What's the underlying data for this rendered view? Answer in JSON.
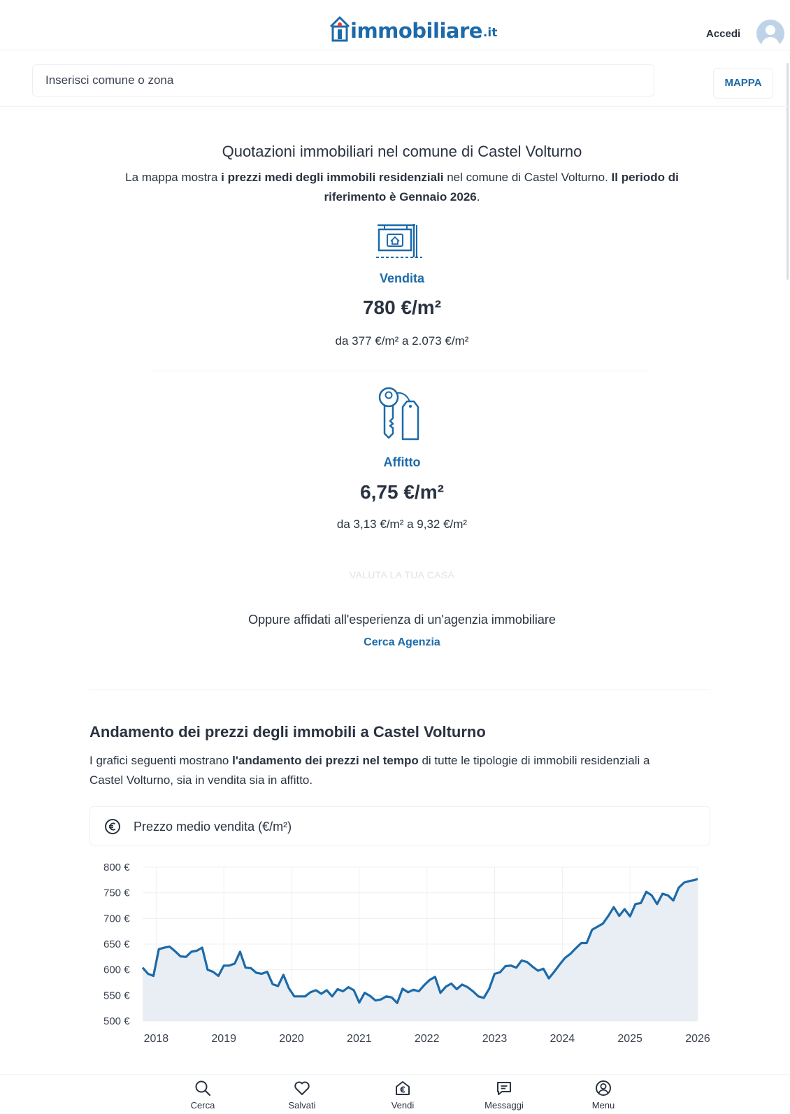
{
  "header": {
    "logo_text": "immobiliare",
    "logo_tld": ".it",
    "login_label": "Accedi"
  },
  "search": {
    "placeholder": "Inserisci comune o zona",
    "map_button_label": "MAPPA"
  },
  "quotes": {
    "title": "Quotazioni immobiliari nel comune di Castel Volturno",
    "desc_part1": "La mappa mostra ",
    "desc_bold1": "i prezzi medi degli immobili residenziali",
    "desc_part2": " nel comune di Castel Volturno. ",
    "desc_bold2": "Il periodo di riferimento è Gennaio 2026",
    "desc_part3": ".",
    "sale": {
      "label": "Vendita",
      "value": "780 €/m²",
      "range": "da 377 €/m² a 2.073 €/m²"
    },
    "rent": {
      "label": "Affitto",
      "value": "6,75 €/m²",
      "range": "da 3,13 €/m² a 9,32 €/m²"
    },
    "valuation_button_label": "VALUTA LA TUA CASA",
    "agency_text": "Oppure affidati all'esperienza di un'agenzia immobiliare",
    "agency_link_label": "Cerca Agenzia"
  },
  "trend": {
    "title": "Andamento dei prezzi degli immobili a Castel Volturno",
    "desc_part1": "I grafici seguenti mostrano ",
    "desc_bold": "l'andamento dei prezzi nel tempo",
    "desc_part2": " di tutte le tipologie di immobili residenziali a Castel Volturno, sia in vendita sia in affitto.",
    "chart_title": "Prezzo medio vendita (€/m²)"
  },
  "chart_data": {
    "type": "area",
    "title": "Prezzo medio vendita (€/m²)",
    "ylim": [
      500,
      800
    ],
    "xlim": [
      2017.8,
      2026
    ],
    "y_ticks": [
      500,
      550,
      600,
      650,
      700,
      750,
      800
    ],
    "y_tick_labels": [
      "500 €",
      "550 €",
      "600 €",
      "650 €",
      "700 €",
      "750 €",
      "800 €"
    ],
    "x_ticks": [
      2018,
      2019,
      2020,
      2021,
      2022,
      2023,
      2024,
      2025,
      2026
    ],
    "x_tick_labels": [
      "2018",
      "2019",
      "2020",
      "2021",
      "2022",
      "2023",
      "2024",
      "2025",
      "2026"
    ],
    "grid": true,
    "color": "#1c6aa9",
    "fill": "#e8eef4",
    "series": [
      {
        "x": [
          2017.8,
          2017.88,
          2017.96,
          2018.04,
          2018.12,
          2018.2,
          2018.28,
          2018.36,
          2018.44,
          2018.52,
          2018.6,
          2018.68,
          2018.76,
          2018.84,
          2018.92,
          2019.0,
          2019.08,
          2019.16,
          2019.24,
          2019.32,
          2019.4,
          2019.48,
          2019.56,
          2019.64,
          2019.72,
          2019.8,
          2019.88,
          2019.96,
          2020.04,
          2020.12,
          2020.2,
          2020.28,
          2020.36,
          2020.44,
          2020.52,
          2020.6,
          2020.68,
          2020.76,
          2020.84,
          2020.92,
          2021.0,
          2021.08,
          2021.16,
          2021.24,
          2021.32,
          2021.4,
          2021.48,
          2021.56,
          2021.64,
          2021.72,
          2021.8,
          2021.88,
          2021.96,
          2022.04,
          2022.12,
          2022.2,
          2022.28,
          2022.36,
          2022.44,
          2022.52,
          2022.6,
          2022.68,
          2022.76,
          2022.84,
          2022.92,
          2023.0,
          2023.08,
          2023.16,
          2023.24,
          2023.32,
          2023.4,
          2023.48,
          2023.56,
          2023.64,
          2023.72,
          2023.8,
          2023.88,
          2023.96,
          2024.04,
          2024.12,
          2024.2,
          2024.28,
          2024.36,
          2024.44,
          2024.52,
          2024.6,
          2024.68,
          2024.76,
          2024.84,
          2024.92,
          2025.0,
          2025.08,
          2025.16,
          2025.24,
          2025.32,
          2025.4,
          2025.48,
          2025.56,
          2025.64,
          2025.72,
          2025.8,
          2025.88,
          2025.96,
          2026.0
        ],
        "y": [
          604,
          592,
          588,
          640,
          643,
          645,
          636,
          626,
          625,
          635,
          637,
          643,
          600,
          596,
          588,
          608,
          608,
          612,
          635,
          604,
          603,
          594,
          592,
          596,
          572,
          568,
          590,
          564,
          548,
          548,
          548,
          556,
          560,
          553,
          560,
          548,
          562,
          558,
          566,
          560,
          536,
          555,
          549,
          540,
          542,
          548,
          546,
          535,
          563,
          556,
          561,
          558,
          570,
          580,
          586,
          555,
          567,
          573,
          562,
          571,
          566,
          558,
          548,
          545,
          563,
          592,
          595,
          607,
          608,
          604,
          618,
          615,
          606,
          598,
          602,
          583,
          596,
          610,
          623,
          631,
          642,
          652,
          652,
          678,
          684,
          690,
          705,
          722,
          705,
          718,
          704,
          728,
          730,
          752,
          745,
          728,
          748,
          745,
          735,
          760,
          770,
          773,
          775,
          777
        ]
      }
    ]
  },
  "bottom_nav": {
    "items": [
      {
        "label": "Cerca",
        "icon": "search-icon"
      },
      {
        "label": "Salvati",
        "icon": "heart-icon"
      },
      {
        "label": "Vendi",
        "icon": "euro-house-icon"
      },
      {
        "label": "Messaggi",
        "icon": "message-icon"
      },
      {
        "label": "Menu",
        "icon": "user-circle-icon"
      }
    ]
  }
}
